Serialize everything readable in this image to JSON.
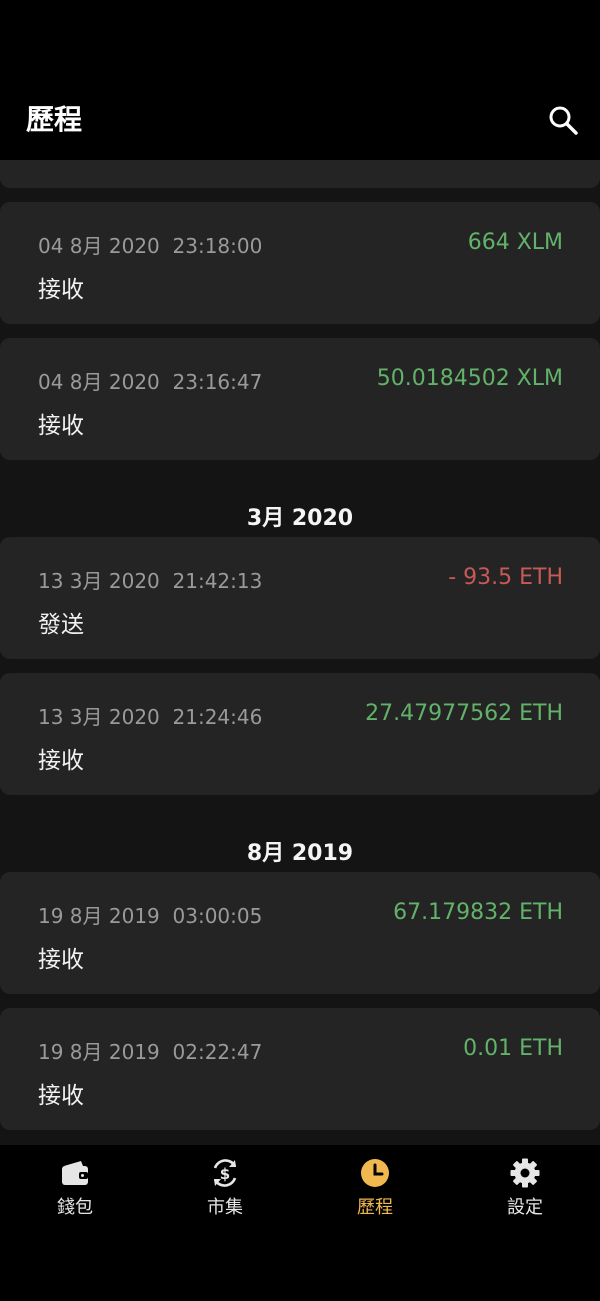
{
  "header": {
    "title": "歷程",
    "search_icon": "search-icon"
  },
  "colors": {
    "positive": "#63b26a",
    "negative": "#c75a57",
    "active_tab": "#f0b84f"
  },
  "history": [
    {
      "date": "04 8月 2020  23:18:00",
      "type": "接收",
      "amount": "664 XLM",
      "direction": "in"
    },
    {
      "date": "04 8月 2020  23:16:47",
      "type": "接收",
      "amount": "50.0184502 XLM",
      "direction": "in"
    },
    {
      "group": "3月 2020"
    },
    {
      "date": "13 3月 2020  21:42:13",
      "type": "發送",
      "amount": "- 93.5 ETH",
      "direction": "out"
    },
    {
      "date": "13 3月 2020  21:24:46",
      "type": "接收",
      "amount": "27.47977562 ETH",
      "direction": "in"
    },
    {
      "group": "8月 2019"
    },
    {
      "date": "19 8月 2019  03:00:05",
      "type": "接收",
      "amount": "67.179832 ETH",
      "direction": "in"
    },
    {
      "date": "19 8月 2019  02:22:47",
      "type": "接收",
      "amount": "0.01 ETH",
      "direction": "in"
    }
  ],
  "tabs": [
    {
      "label": "錢包",
      "icon": "wallet-icon"
    },
    {
      "label": "市集",
      "icon": "market-exchange-icon"
    },
    {
      "label": "歷程",
      "icon": "clock-icon",
      "active": true
    },
    {
      "label": "設定",
      "icon": "gear-icon"
    }
  ]
}
